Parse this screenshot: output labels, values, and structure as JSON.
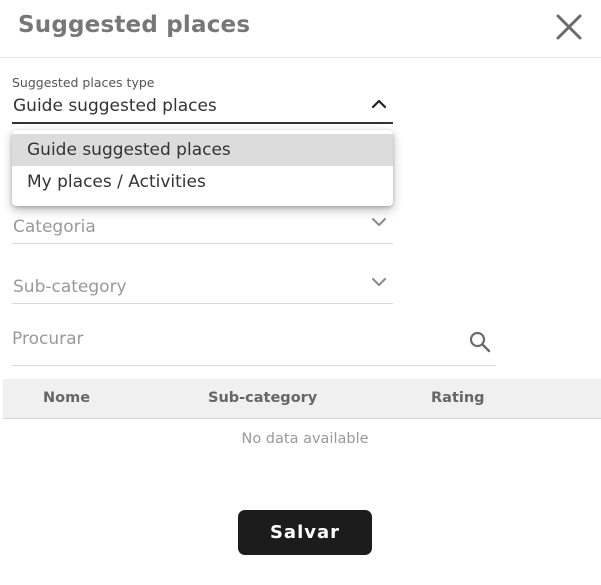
{
  "dialog": {
    "title": "Suggested places"
  },
  "type_select": {
    "label": "Suggested places type",
    "value": "Guide suggested places",
    "options": [
      "Guide suggested places",
      "My places / Activities"
    ]
  },
  "category_select": {
    "placeholder": "Categoria"
  },
  "subcategory_select": {
    "placeholder": "Sub-category"
  },
  "search": {
    "placeholder": "Procurar"
  },
  "table": {
    "columns": [
      "Nome",
      "Sub-category",
      "Rating"
    ],
    "empty_text": "No data available"
  },
  "actions": {
    "save_label": "Salvar"
  },
  "colors": {
    "accent": "#1c1c1c",
    "header_bg": "#f0f0f0",
    "selected_option_bg": "#dcdcdc"
  },
  "icons": [
    "close-icon",
    "chevron-up-icon",
    "chevron-down-icon",
    "search-icon"
  ]
}
